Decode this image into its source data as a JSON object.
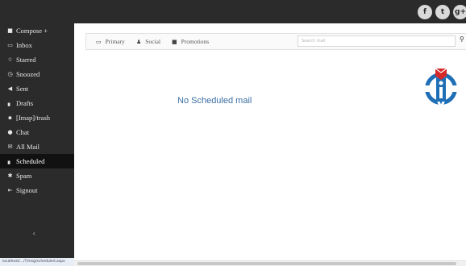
{
  "sidebar": {
    "items": [
      {
        "label": "Compose +",
        "icon": "compose-icon",
        "glyph": "■"
      },
      {
        "label": "Inbox",
        "icon": "inbox-icon",
        "glyph": "▭"
      },
      {
        "label": "Starred",
        "icon": "star-icon",
        "glyph": "☆"
      },
      {
        "label": "Snoozed",
        "icon": "clock-icon",
        "glyph": "◷"
      },
      {
        "label": "Sent",
        "icon": "send-icon",
        "glyph": "◀"
      },
      {
        "label": "Drafts",
        "icon": "draft-icon",
        "glyph": "▖"
      },
      {
        "label": "[Imap]/trash",
        "icon": "trash-icon",
        "glyph": "▪"
      },
      {
        "label": "Chat",
        "icon": "chat-icon",
        "glyph": "●"
      },
      {
        "label": "All Mail",
        "icon": "envelope-icon",
        "glyph": "✉"
      },
      {
        "label": "Scheduled",
        "icon": "scheduled-icon",
        "glyph": "▖",
        "active": true
      },
      {
        "label": "Spam",
        "icon": "spam-icon",
        "glyph": "✱"
      },
      {
        "label": "Signout",
        "icon": "signout-icon",
        "glyph": "⇤"
      }
    ],
    "collapse_glyph": "‹"
  },
  "topbar": {
    "social": [
      {
        "icon": "facebook-icon",
        "glyph": "f"
      },
      {
        "icon": "twitter-icon",
        "glyph": "t"
      },
      {
        "icon": "google-plus-icon",
        "glyph": "g+"
      }
    ]
  },
  "tabs": [
    {
      "label": "Primary",
      "icon": "inbox-tray-icon",
      "glyph": "▭"
    },
    {
      "label": "Social",
      "icon": "people-icon",
      "glyph": "♟"
    },
    {
      "label": "Promotions",
      "icon": "tag-icon",
      "glyph": "■"
    }
  ],
  "search": {
    "placeholder": "Search mail",
    "icon_glyph": "⚲"
  },
  "main": {
    "empty_message": "No Scheduled mail"
  },
  "statusbar": {
    "url": "localhost/.../?/msg/scheduled.aspx"
  },
  "colors": {
    "chrome": "#2b2b2b",
    "active_item": "#111111",
    "message": "#3a6ea5",
    "logo_blue": "#1f6fb7",
    "logo_red": "#d62828"
  }
}
